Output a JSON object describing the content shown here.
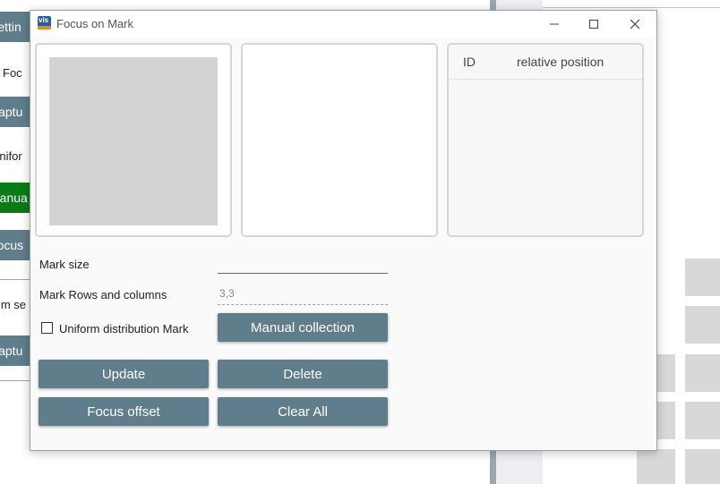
{
  "background_app": {
    "left_buttons": [
      {
        "label": "Settin"
      },
      {
        "label": "Captu"
      },
      {
        "label": "Manua"
      },
      {
        "label": "Focus"
      },
      {
        "label": "Captu"
      }
    ],
    "left_texts": [
      {
        "label": "ls Foc"
      },
      {
        "label": "Unifor"
      },
      {
        "label": "thm se"
      }
    ]
  },
  "window": {
    "title": "Focus on Mark",
    "icon_text": "vis"
  },
  "table": {
    "columns": [
      "ID",
      "relative position"
    ],
    "rows": []
  },
  "form": {
    "mark_size_label": "Mark size",
    "mark_size_value": "",
    "rows_cols_label": "Mark Rows and columns",
    "rows_cols_value": "3,3",
    "uniform_label": "Uniform distribution Mark",
    "uniform_checked": false
  },
  "buttons": {
    "manual_collection": "Manual collection",
    "update": "Update",
    "delete": "Delete",
    "focus_offset": "Focus offset",
    "clear_all": "Clear All"
  },
  "colors": {
    "button": "#607d8b",
    "manual_bg_button": "#0a7a17",
    "placeholder": "#d3d3d3"
  }
}
